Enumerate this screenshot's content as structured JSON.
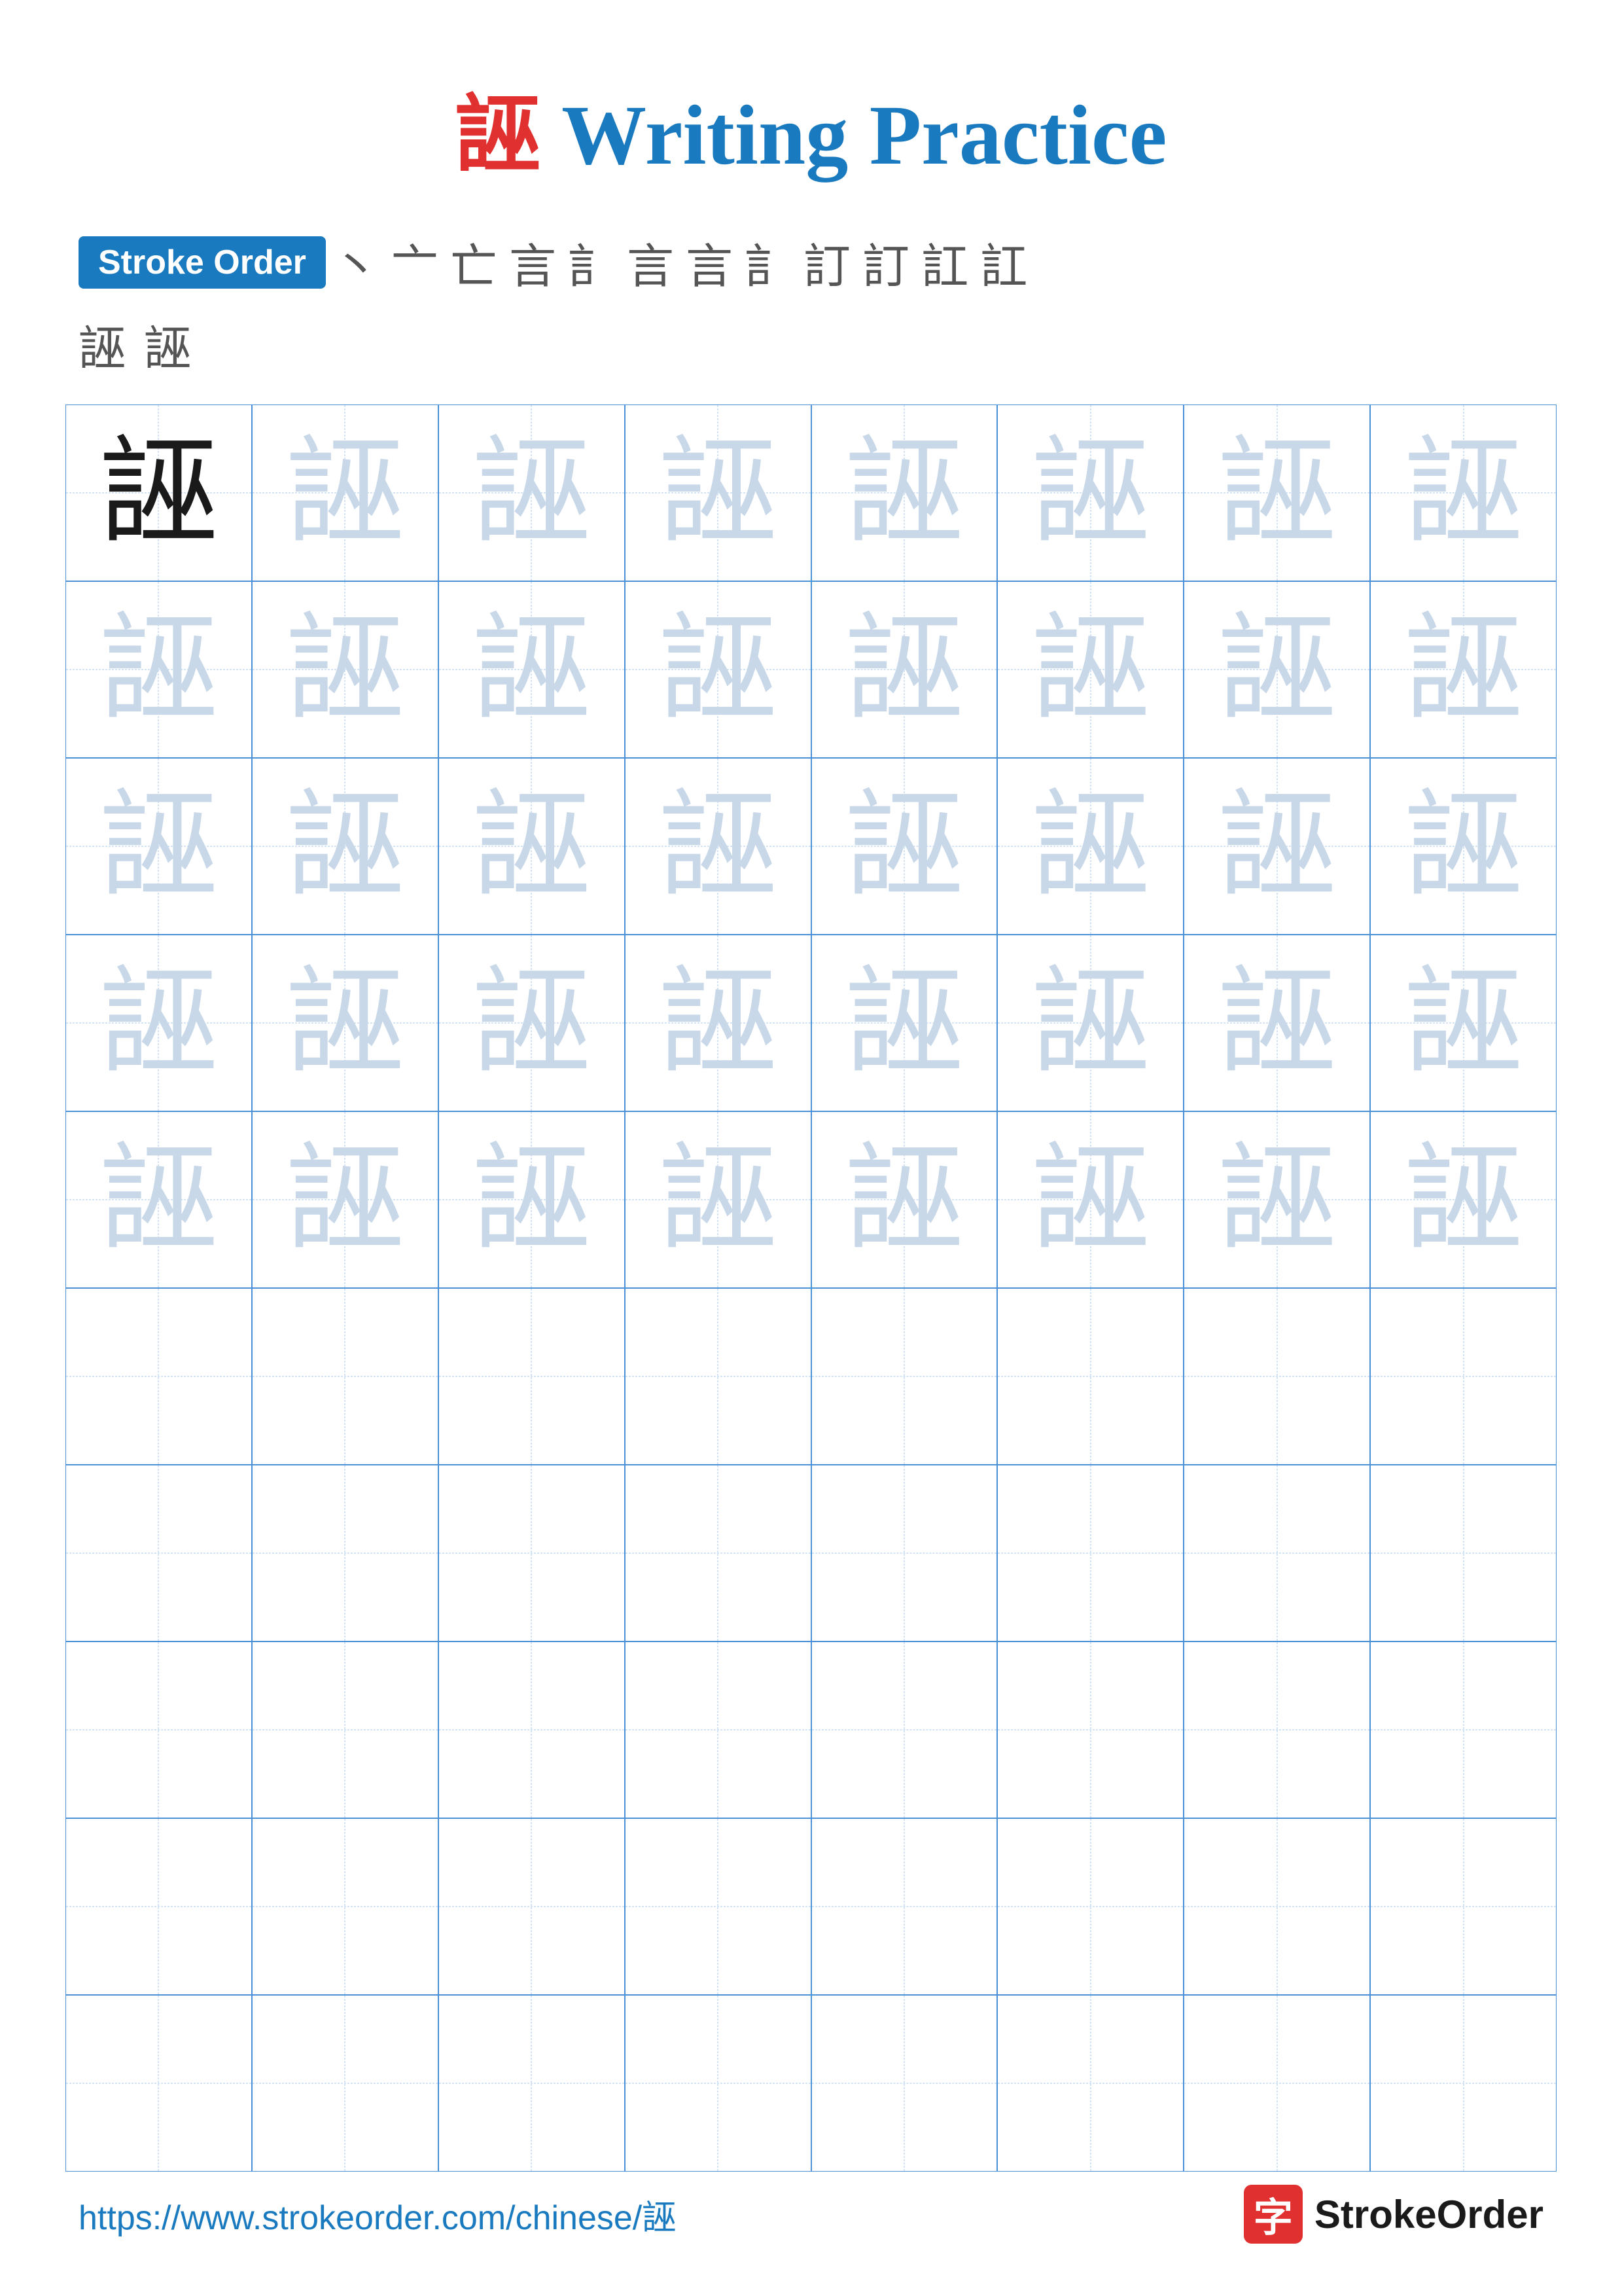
{
  "header": {
    "char": "誣",
    "title": "Writing Practice",
    "char_color": "#e03030",
    "title_color": "#1a7abf"
  },
  "stroke_order": {
    "label": "Stroke Order",
    "strokes": [
      "丶",
      "亠",
      "亡",
      "言",
      "訁",
      "言",
      "言",
      "訁",
      "訂",
      "訂",
      "訌",
      "訌"
    ],
    "strokes_row2": [
      "誣",
      "誣"
    ]
  },
  "grid": {
    "rows": 10,
    "cols": 8,
    "char": "誣",
    "filled_rows": 5
  },
  "footer": {
    "url": "https://www.strokeorder.com/chinese/誣",
    "logo_char": "字",
    "logo_text": "StrokeOrder"
  }
}
